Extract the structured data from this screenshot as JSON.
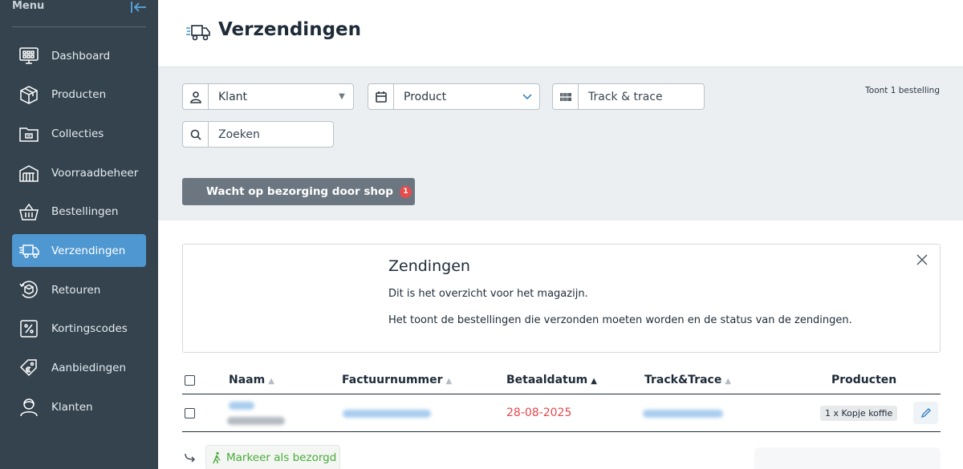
{
  "sidebar": {
    "title": "Menu",
    "items": [
      {
        "label": "Dashboard",
        "icon": "dashboard-icon"
      },
      {
        "label": "Producten",
        "icon": "box-icon"
      },
      {
        "label": "Collecties",
        "icon": "folder-icon"
      },
      {
        "label": "Voorraadbeheer",
        "icon": "warehouse-icon"
      },
      {
        "label": "Bestellingen",
        "icon": "basket-icon"
      },
      {
        "label": "Verzendingen",
        "icon": "truck-icon"
      },
      {
        "label": "Retouren",
        "icon": "return-box-icon"
      },
      {
        "label": "Kortingscodes",
        "icon": "percent-tag-icon"
      },
      {
        "label": "Aanbiedingen",
        "icon": "euro-tag-icon"
      },
      {
        "label": "Klanten",
        "icon": "user-icon"
      }
    ],
    "active_index": 5
  },
  "header": {
    "title": "Verzendingen"
  },
  "filters": {
    "klant": "Klant",
    "product": "Product",
    "track": "Track & trace",
    "search": "Zoeken",
    "count_text": "Toont 1 bestelling"
  },
  "status_button": {
    "label": "Wacht op bezorging door shop",
    "badge": "1"
  },
  "info": {
    "title": "Zendingen",
    "line1": "Dit is het overzicht voor het magazijn.",
    "line2": "Het toont de bestellingen die verzonden moeten worden en de status van de zendingen."
  },
  "table": {
    "columns": [
      "Naam",
      "Factuurnummer",
      "Betaaldatum",
      "Track&Trace",
      "Producten"
    ],
    "rows": [
      {
        "betaaldatum": "28-08-2025",
        "producten": "1 x Kopje koffie"
      }
    ]
  },
  "actions": {
    "mark_delivered": "Markeer als bezorgd"
  },
  "colors": {
    "sidebar": "#34434e",
    "active": "#4f97d1",
    "danger": "#e6484b",
    "success": "#49ab3c"
  }
}
